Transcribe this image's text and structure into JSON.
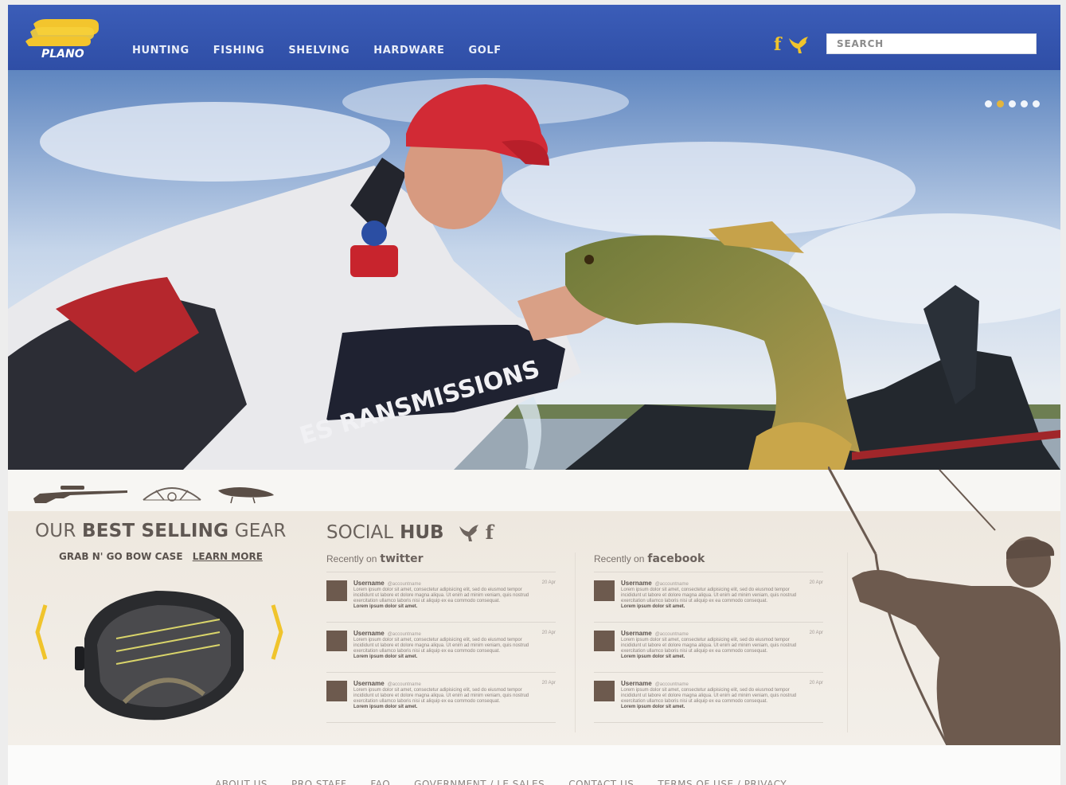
{
  "header": {
    "brand": "PLANO",
    "nav": [
      "HUNTING",
      "FISHING",
      "SHELVING",
      "HARDWARE",
      "GOLF"
    ],
    "social": {
      "facebook": "f",
      "twitter_icon": "bird-icon"
    },
    "search_placeholder": "SEARCH"
  },
  "hero": {
    "slides": 5,
    "active_slide": 1,
    "jersey_text": "ES RANSMISSIONS"
  },
  "categories": [
    "rifle-icon",
    "bow-icon",
    "lure-icon"
  ],
  "gear": {
    "title_prefix": "OUR ",
    "title_bold": "BEST SELLING",
    "title_suffix": " GEAR",
    "product": "GRAB N' GO BOW CASE",
    "learn_more": "LEARN MORE"
  },
  "social_hub": {
    "title": "SOCIAL",
    "title_bold": "HUB",
    "f": "f",
    "twitter": {
      "label": "Recently on",
      "network": "twitter",
      "posts": [
        {
          "user": "Username",
          "handle": "@accountname",
          "date": "20 Apr",
          "text": "Lorem ipsum dolor sit amet, consectetur adipisicing elit, sed do eiusmod tempor incididunt ut labore et dolore magna aliqua. Ut enim ad minim veniam, quis nostrud exercitation ullamco laboris nisi ut aliquip ex ea commodo consequat.",
          "lead": "Lorem ipsum dolor sit amet."
        },
        {
          "user": "Username",
          "handle": "@accountname",
          "date": "20 Apr",
          "text": "Lorem ipsum dolor sit amet, consectetur adipisicing elit, sed do eiusmod tempor incididunt ut labore et dolore magna aliqua. Ut enim ad minim veniam, quis nostrud exercitation ullamco laboris nisi ut aliquip ex ea commodo consequat.",
          "lead": "Lorem ipsum dolor sit amet."
        },
        {
          "user": "Username",
          "handle": "@accountname",
          "date": "20 Apr",
          "text": "Lorem ipsum dolor sit amet, consectetur adipisicing elit, sed do eiusmod tempor incididunt ut labore et dolore magna aliqua. Ut enim ad minim veniam, quis nostrud exercitation ullamco laboris nisi ut aliquip ex ea commodo consequat.",
          "lead": "Lorem ipsum dolor sit amet."
        }
      ]
    },
    "facebook": {
      "label": "Recently on",
      "network": "facebook",
      "posts": [
        {
          "user": "Username",
          "handle": "@accountname",
          "date": "20 Apr",
          "text": "Lorem ipsum dolor sit amet, consectetur adipisicing elit, sed do eiusmod tempor incididunt ut labore et dolore magna aliqua. Ut enim ad minim veniam, quis nostrud exercitation ullamco laboris nisi ut aliquip ex ea commodo consequat.",
          "lead": "Lorem ipsum dolor sit amet."
        },
        {
          "user": "Username",
          "handle": "@accountname",
          "date": "20 Apr",
          "text": "Lorem ipsum dolor sit amet, consectetur adipisicing elit, sed do eiusmod tempor incididunt ut labore et dolore magna aliqua. Ut enim ad minim veniam, quis nostrud exercitation ullamco laboris nisi ut aliquip ex ea commodo consequat.",
          "lead": "Lorem ipsum dolor sit amet."
        },
        {
          "user": "Username",
          "handle": "@accountname",
          "date": "20 Apr",
          "text": "Lorem ipsum dolor sit amet, consectetur adipisicing elit, sed do eiusmod tempor incididunt ut labore et dolore magna aliqua. Ut enim ad minim veniam, quis nostrud exercitation ullamco laboris nisi ut aliquip ex ea commodo consequat.",
          "lead": "Lorem ipsum dolor sit amet."
        }
      ]
    }
  },
  "footer": {
    "links": [
      "ABOUT US",
      "PRO STAFF",
      "FAQ",
      "GOVERNMENT / LE SALES",
      "CONTACT US",
      "TERMS OF USE / PRIVACY"
    ]
  },
  "colors": {
    "header_blue": "#3352ab",
    "accent_yellow": "#f0c42c",
    "brown": "#6d5a4e"
  }
}
